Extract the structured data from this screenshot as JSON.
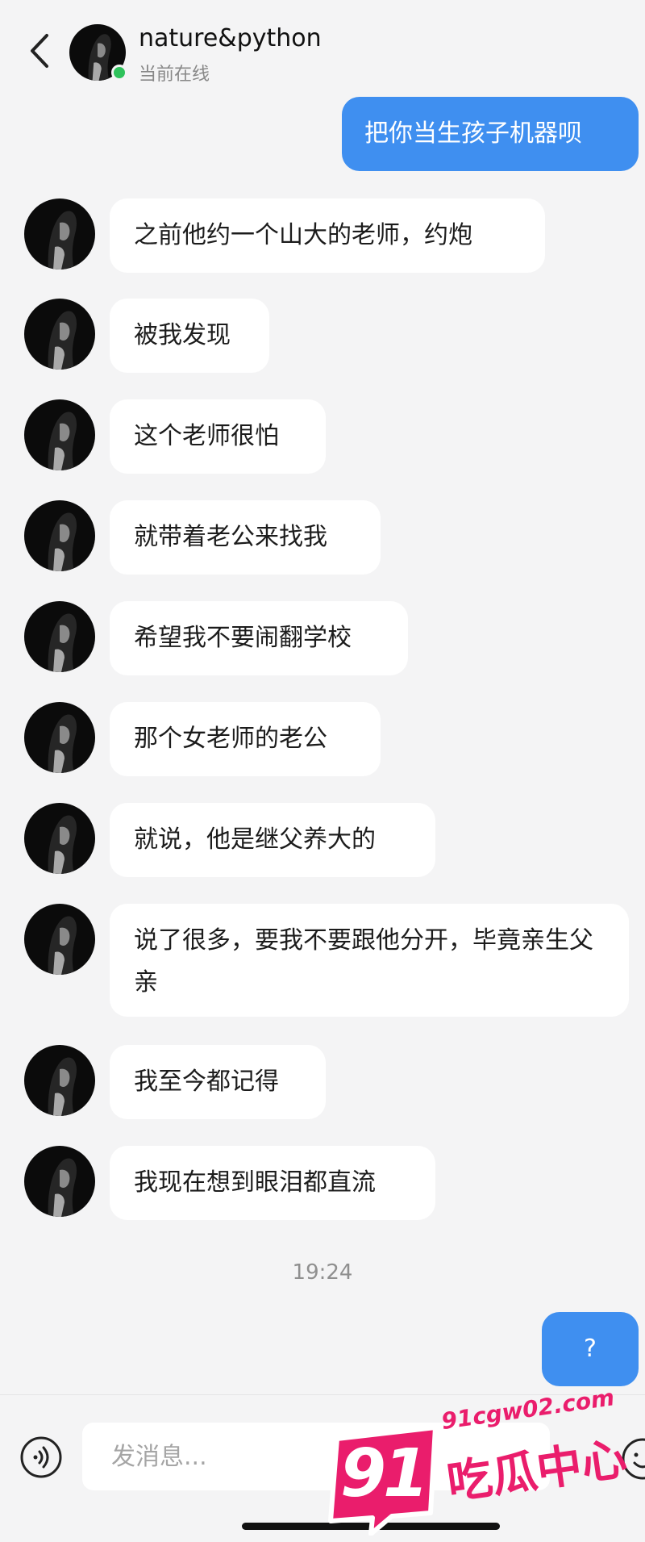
{
  "header": {
    "contact_name": "nature&python",
    "status": "当前在线"
  },
  "messages": [
    {
      "side": "out",
      "text": "把你当生孩子机器呗"
    },
    {
      "side": "in",
      "text": "之前他约一个山大的老师，约炮"
    },
    {
      "side": "in",
      "text": "被我发现"
    },
    {
      "side": "in",
      "text": "这个老师很怕"
    },
    {
      "side": "in",
      "text": "就带着老公来找我"
    },
    {
      "side": "in",
      "text": "希望我不要闹翻学校"
    },
    {
      "side": "in",
      "text": "那个女老师的老公"
    },
    {
      "side": "in",
      "text": "就说，他是继父养大的"
    },
    {
      "side": "in",
      "text": "说了很多，要我不要跟他分开，毕竟亲生父亲"
    },
    {
      "side": "in",
      "text": "我至今都记得"
    },
    {
      "side": "in",
      "text": "我现在想到眼泪都直流"
    },
    {
      "side": "out",
      "text": "?"
    }
  ],
  "timestamp": "19:24",
  "composer": {
    "placeholder": "发消息..."
  },
  "watermark": {
    "number": "91",
    "domain": "91cgw02.com",
    "brand": "吃瓜中心"
  },
  "colors": {
    "outgoing_bubble": "#3f8ff0",
    "incoming_bubble": "#ffffff",
    "background": "#f4f4f5",
    "online": "#2ec25b",
    "watermark": "#ea1d6c"
  },
  "icons": [
    "back-arrow-icon",
    "online-dot",
    "voice-icon",
    "emoji-icon"
  ]
}
